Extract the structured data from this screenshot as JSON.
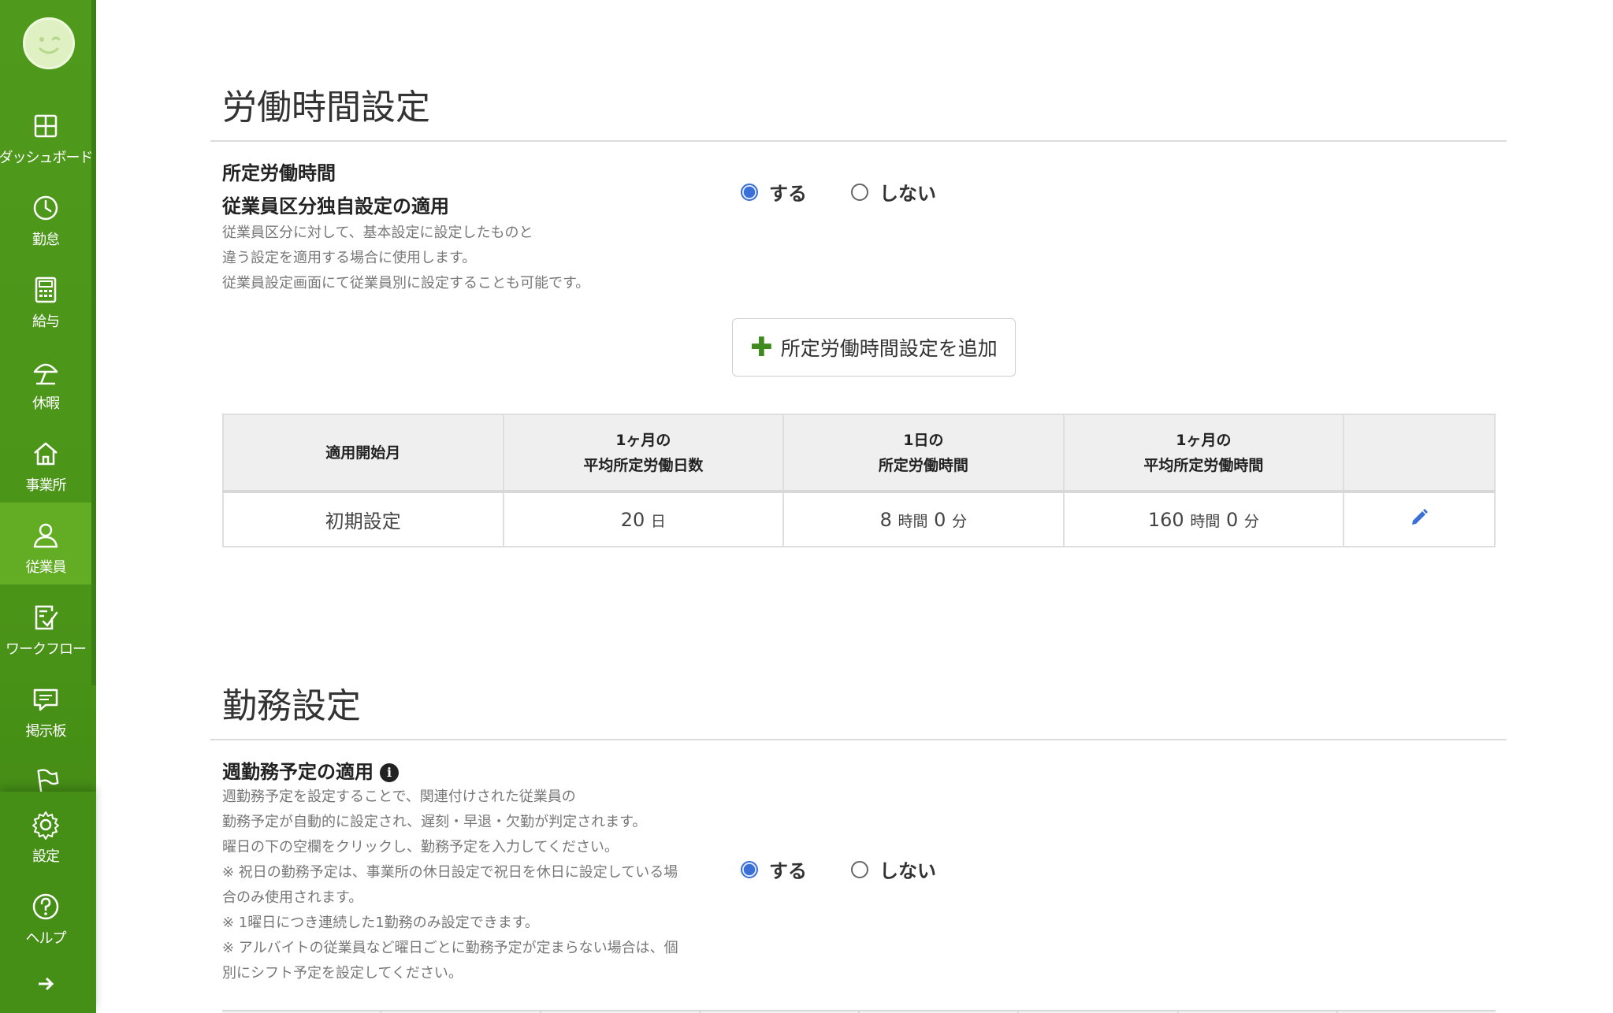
{
  "sidebar": {
    "logo_icon": "smiley-face-icon",
    "items": [
      {
        "label": "ダッシュボード",
        "icon": "dashboard-icon"
      },
      {
        "label": "勤怠",
        "icon": "clock-icon"
      },
      {
        "label": "給与",
        "icon": "calculator-icon"
      },
      {
        "label": "休暇",
        "icon": "umbrella-icon"
      },
      {
        "label": "事業所",
        "icon": "home-icon"
      },
      {
        "label": "従業員",
        "icon": "person-icon",
        "active": true
      },
      {
        "label": "ワークフロー",
        "icon": "checklist-icon"
      },
      {
        "label": "掲示板",
        "icon": "chat-icon"
      },
      {
        "label": "",
        "icon": "flag-icon"
      }
    ],
    "bottom_items": [
      {
        "label": "設定",
        "icon": "gear-icon"
      },
      {
        "label": "ヘルプ",
        "icon": "help-icon"
      }
    ],
    "expand_icon": "arrow-right-icon",
    "colors": {
      "background": "#4a9418",
      "active": "#62ad24"
    }
  },
  "work_hours": {
    "title": "労働時間設定",
    "setting_label_line1": "所定労働時間",
    "setting_label_line2": "従業員区分独自設定の適用",
    "description": [
      "従業員区分に対して、基本設定に設定したものと",
      "違う設定を適用する場合に使用します。",
      "従業員設定画面にて従業員別に設定することも可能です。"
    ],
    "radio_yes": "する",
    "radio_no": "しない",
    "selected": "する",
    "add_button_label": "所定労働時間設定を追加",
    "table": {
      "headers": [
        [
          "適用開始月"
        ],
        [
          "1ヶ月の",
          "平均所定労働日数"
        ],
        [
          "1日の",
          "所定労働時間"
        ],
        [
          "1ヶ月の",
          "平均所定労働時間"
        ],
        [
          ""
        ]
      ],
      "rows": [
        {
          "start": "初期設定",
          "days_value": "20",
          "days_unit": "日",
          "daily_hours": "8",
          "daily_hours_unit": "時間",
          "daily_minutes": "0",
          "daily_minutes_unit": "分",
          "monthly_hours": "160",
          "monthly_hours_unit": "時間",
          "monthly_minutes": "0",
          "monthly_minutes_unit": "分"
        }
      ]
    }
  },
  "work_schedule": {
    "title": "勤務設定",
    "setting_label": "週勤務予定の適用",
    "info_icon": "info-icon",
    "description": [
      "週勤務予定を設定することで、関連付けされた従業員の",
      "勤務予定が自動的に設定され、遅刻・早退・欠勤が判定されます。",
      "曜日の下の空欄をクリックし、勤務予定を入力してください。",
      "※ 祝日の勤務予定は、事業所の休日設定で祝日を休日に設定している場",
      "合のみ使用されます。",
      "※ 1曜日につき連続した1勤務のみ設定できます。",
      "※ アルバイトの従業員など曜日ごとに勤務予定が定まらない場合は、個",
      "別にシフト予定を設定してください。"
    ],
    "radio_yes": "する",
    "radio_no": "しない",
    "selected": "する"
  }
}
